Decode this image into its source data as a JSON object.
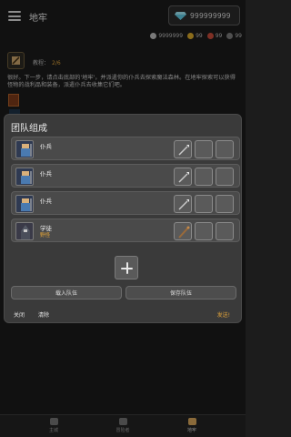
{
  "header": {
    "title": "地牢",
    "gems": "999999999"
  },
  "currencies": [
    {
      "name": "silver",
      "value": "9999999",
      "color": "#bcbcbc"
    },
    {
      "name": "gold",
      "value": "99",
      "color": "#d6a62a"
    },
    {
      "name": "red",
      "value": "99",
      "color": "#c44a3a"
    },
    {
      "name": "dark",
      "value": "99",
      "color": "#7a7a7a"
    }
  ],
  "quest": {
    "label": "教程：",
    "progress": "2/6",
    "text": "很好。下一步，请点击底部的'地牢'，并派遣你的仆兵去探索魔法森林。在地牢探索可以获得怪物的战利品和装备，派遣仆兵去收集它们吧。"
  },
  "party": {
    "title": "团队组成",
    "units": [
      {
        "name": "仆兵",
        "sub": "",
        "weapon": "spear"
      },
      {
        "name": "仆兵",
        "sub": "",
        "weapon": "spear"
      },
      {
        "name": "仆兵",
        "sub": "",
        "weapon": "spear"
      },
      {
        "name": "学徒",
        "sub": "野怪",
        "weapon": "staff"
      }
    ],
    "load_label": "载入队伍",
    "save_label": "保存队伍",
    "close_label": "关闭",
    "clear_label": "清除",
    "send_label": "发送!"
  },
  "nav": {
    "items": [
      {
        "label": "主城"
      },
      {
        "label": "冒险者"
      },
      {
        "label": "地牢"
      }
    ]
  }
}
